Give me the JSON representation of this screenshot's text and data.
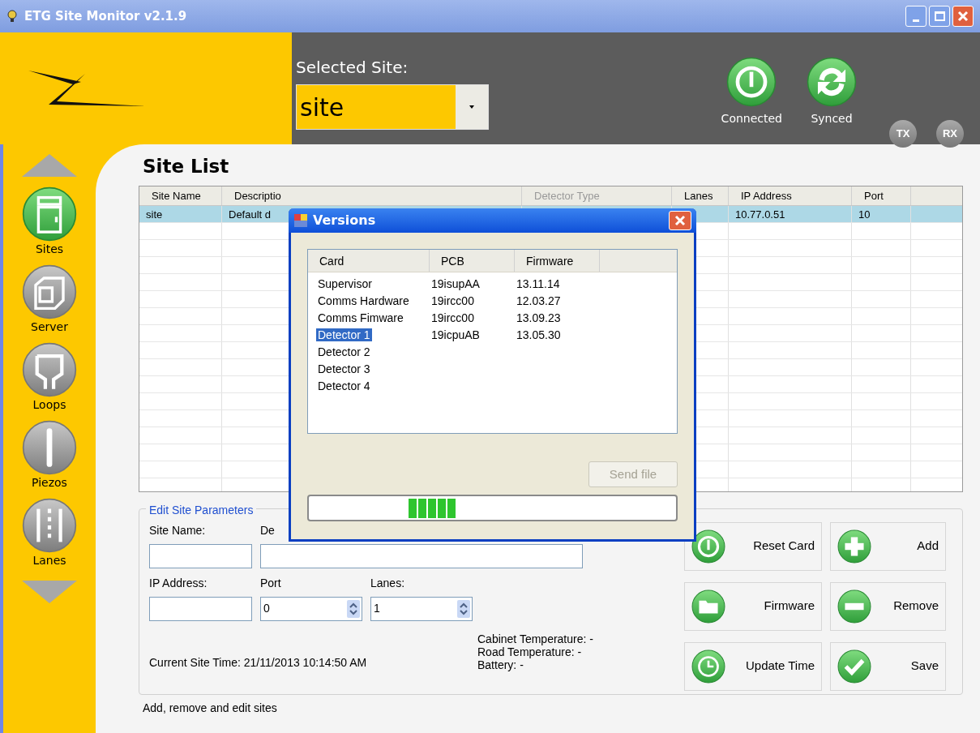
{
  "window": {
    "title": "ETG Site Monitor v2.1.9"
  },
  "header": {
    "selected_site_label": "Selected Site:",
    "selected_site": "site",
    "status": [
      {
        "label": "Connected",
        "kind": "power"
      },
      {
        "label": "Synced",
        "kind": "sync"
      }
    ],
    "indicators": [
      "TX",
      "RX"
    ]
  },
  "sidebar": {
    "items": [
      {
        "label": "Sites",
        "kind": "cabinet",
        "selected": true
      },
      {
        "label": "Server",
        "kind": "server",
        "selected": false
      },
      {
        "label": "Loops",
        "kind": "loop",
        "selected": false
      },
      {
        "label": "Piezos",
        "kind": "piezo",
        "selected": false
      },
      {
        "label": "Lanes",
        "kind": "lanes",
        "selected": false
      }
    ]
  },
  "site_list": {
    "title": "Site List",
    "columns": [
      "Site Name",
      "Descriptio",
      "Detector Type",
      "Lanes",
      "IP Address",
      "Port"
    ],
    "rows": [
      {
        "site_name": "site",
        "description": "Default d",
        "ip_address": "10.77.0.51",
        "port": "10",
        "selected": true
      }
    ]
  },
  "edit": {
    "legend": "Edit Site Parameters",
    "site_name_label": "Site Name:",
    "description_label": "De",
    "ip_label": "IP Address:",
    "port_label": "Port",
    "port_value": "0",
    "lanes_label": "Lanes:",
    "lanes_value": "1",
    "site_time": "Current Site Time: 21/11/2013 10:14:50 AM",
    "readings": [
      "Cabinet Temperature: -",
      "Road Temperature: -",
      "Battery: -"
    ]
  },
  "actions": [
    {
      "label": "Reset Card",
      "kind": "power"
    },
    {
      "label": "Add",
      "kind": "plus"
    },
    {
      "label": "Firmware",
      "kind": "folder"
    },
    {
      "label": "Remove",
      "kind": "minus"
    },
    {
      "label": "Update Time",
      "kind": "clock"
    },
    {
      "label": "Save",
      "kind": "check"
    }
  ],
  "status_text": "Add, remove and edit sites",
  "dialog": {
    "title": "Versions",
    "columns": [
      "Card",
      "PCB",
      "Firmware"
    ],
    "rows": [
      {
        "card": "Supervisor",
        "pcb": "19isupAA",
        "firmware": "13.11.14",
        "selected": false
      },
      {
        "card": "Comms Hardware",
        "pcb": "19ircc00",
        "firmware": "12.03.27",
        "selected": false
      },
      {
        "card": "Comms Fimware",
        "pcb": "19ircc00",
        "firmware": "13.09.23",
        "selected": false
      },
      {
        "card": "Detector 1",
        "pcb": "19icpuAB",
        "firmware": "13.05.30",
        "selected": true
      },
      {
        "card": "Detector 2",
        "selected": false
      },
      {
        "card": "Detector 3",
        "selected": false
      },
      {
        "card": "Detector 4",
        "selected": false
      }
    ],
    "send_button": {
      "label": "Send file",
      "disabled": true
    },
    "progress": {
      "level": 0.4
    }
  }
}
